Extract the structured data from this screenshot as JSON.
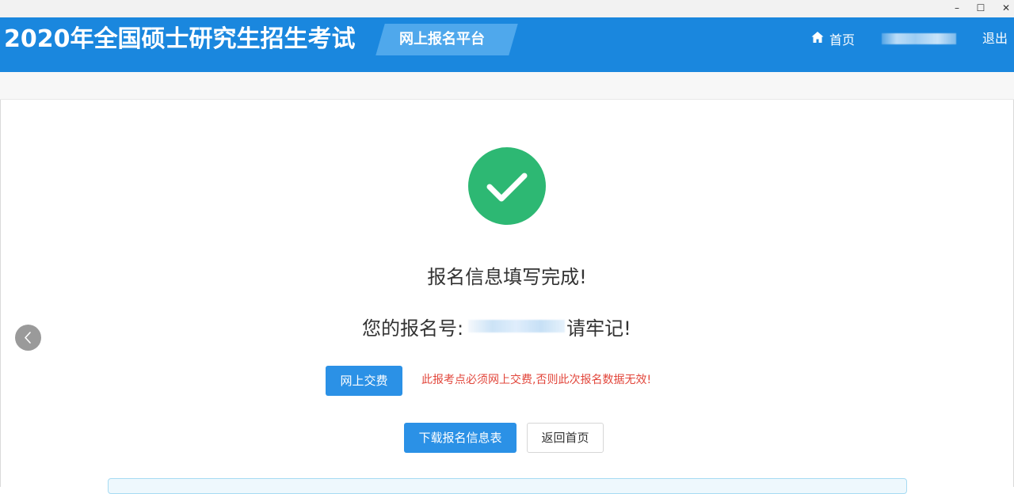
{
  "window": {
    "minimize_glyph": "–",
    "maximize_glyph": "☐",
    "close_glyph": "✕"
  },
  "header": {
    "site_title": "2020年全国硕士研究生招生考试",
    "platform_tag": "网上报名平台",
    "nav": {
      "home_label": "首页",
      "home_icon": "home-icon",
      "user_name": "",
      "logout_label": "退出"
    },
    "colors": {
      "header_bg": "#1a87de",
      "tag_bg": "#4fa8ec"
    }
  },
  "main": {
    "success_icon": "check-circle-icon",
    "success_color": "#2db873",
    "message_title": "报名信息填写完成!",
    "number_prefix": "您的报名号:",
    "registration_number": "",
    "number_suffix": "请牢记!",
    "pay_button": "网上交费",
    "warning_text": "此报考点必须网上交费,否则此次报名数据无效!",
    "warning_color": "#e2463b",
    "download_button": "下载报名信息表",
    "return_button": "返回首页",
    "prev_icon": "chevron-left-icon"
  }
}
